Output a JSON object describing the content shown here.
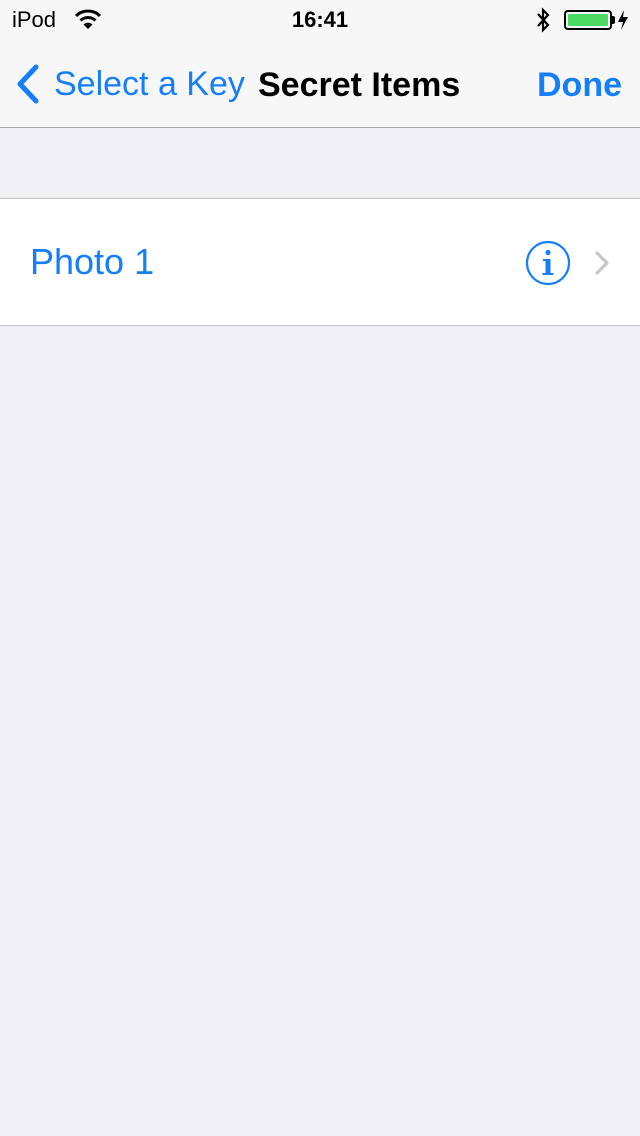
{
  "status_bar": {
    "carrier": "iPod",
    "time": "16:41",
    "icons": [
      "wifi-icon",
      "bluetooth-icon",
      "battery-icon",
      "charging-icon"
    ]
  },
  "nav_bar": {
    "back_label": "Select a Key",
    "title": "Secret Items",
    "done_label": "Done"
  },
  "list": {
    "items": [
      {
        "label": "Photo 1",
        "accessories": [
          "info-icon",
          "chevron-right-icon"
        ]
      }
    ]
  },
  "colors": {
    "accent": "#147efb",
    "background": "#efeff4",
    "battery": "#4cd964"
  }
}
